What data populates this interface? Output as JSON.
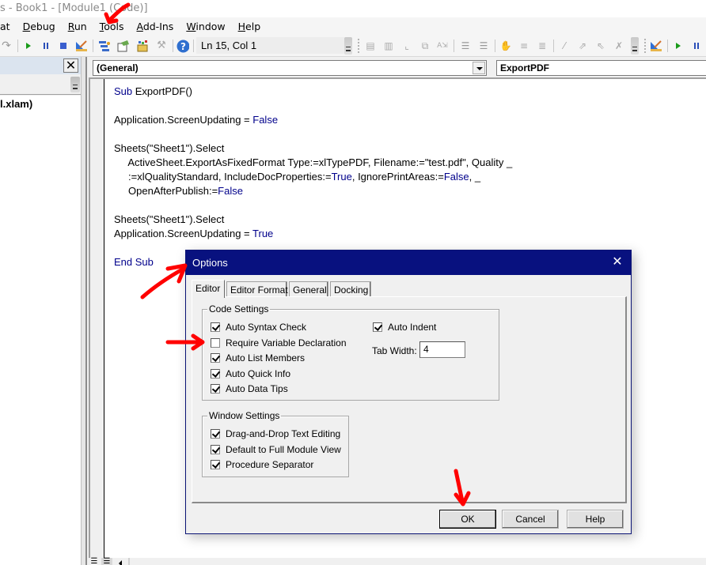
{
  "window": {
    "title": "s - Book1 - [Module1 (Code)]"
  },
  "menu": {
    "items": [
      {
        "label": "at",
        "accel": ""
      },
      {
        "label": "Debug",
        "accel": "D"
      },
      {
        "label": "Run",
        "accel": "R"
      },
      {
        "label": "Tools",
        "accel": "T"
      },
      {
        "label": "Add-Ins",
        "accel": "A"
      },
      {
        "label": "Window",
        "accel": "W"
      },
      {
        "label": "Help",
        "accel": "H"
      }
    ]
  },
  "toolbar": {
    "position_text": "Ln 15, Col 1",
    "icons": [
      "redo-icon",
      "run-icon",
      "break-icon",
      "reset-icon",
      "design-mode-icon",
      "project-explorer-icon",
      "properties-icon",
      "object-browser-icon",
      "toolbox-icon",
      "help-icon"
    ],
    "edit_icons": [
      "list-properties-icon",
      "list-constants-icon",
      "quick-info-icon",
      "parameter-info-icon",
      "complete-word-icon",
      "indent-icon",
      "outdent-icon",
      "toggle-breakpoint-icon",
      "comment-block-icon",
      "uncomment-block-icon",
      "toggle-bookmark-icon",
      "next-bookmark-icon",
      "previous-bookmark-icon",
      "clear-bookmarks-icon"
    ],
    "right_icons": [
      "design-mode-icon",
      "run-icon",
      "break-icon"
    ]
  },
  "project": {
    "close_label": "✕",
    "tree_item": "l.xlam)"
  },
  "editor": {
    "object_combo": "(General)",
    "procedure_combo": "ExportPDF",
    "code_lines": [
      [
        {
          "t": "Sub",
          "k": true
        },
        {
          "t": " ExportPDF()",
          "k": false
        }
      ],
      [],
      [
        {
          "t": "Application.ScreenUpdating = ",
          "k": false
        },
        {
          "t": "False",
          "k": true
        }
      ],
      [],
      [
        {
          "t": "Sheets(\"Sheet1\").Select",
          "k": false
        }
      ],
      [
        {
          "t": "     ActiveSheet.ExportAsFixedFormat Type:=xlTypePDF, Filename:=\"test.pdf\", Quality _",
          "k": false
        }
      ],
      [
        {
          "t": "     :=xlQualityStandard, IncludeDocProperties:=",
          "k": false
        },
        {
          "t": "True",
          "k": true
        },
        {
          "t": ", IgnorePrintAreas:=",
          "k": false
        },
        {
          "t": "False",
          "k": true
        },
        {
          "t": ", _",
          "k": false
        }
      ],
      [
        {
          "t": "     OpenAfterPublish:=",
          "k": false
        },
        {
          "t": "False",
          "k": true
        }
      ],
      [],
      [
        {
          "t": "Sheets(\"Sheet1\").Select",
          "k": false
        }
      ],
      [
        {
          "t": "Application.ScreenUpdating = ",
          "k": false
        },
        {
          "t": "True",
          "k": true
        }
      ],
      [],
      [
        {
          "t": "End Sub",
          "k": true
        }
      ]
    ]
  },
  "dialog": {
    "title": "Options",
    "close_label": "✕",
    "tabs": [
      {
        "label": "Editor",
        "active": true
      },
      {
        "label": "Editor Format",
        "active": false
      },
      {
        "label": "General",
        "active": false
      },
      {
        "label": "Docking",
        "active": false
      }
    ],
    "code_settings": {
      "label": "Code Settings",
      "options": [
        {
          "label": "Auto Syntax Check",
          "checked": true
        },
        {
          "label": "Require Variable Declaration",
          "checked": false
        },
        {
          "label": "Auto List Members",
          "checked": true
        },
        {
          "label": "Auto Quick Info",
          "checked": true
        },
        {
          "label": "Auto Data Tips",
          "checked": true
        }
      ],
      "auto_indent": {
        "label": "Auto Indent",
        "checked": true
      },
      "tab_width_label": "Tab Width:",
      "tab_width_value": "4"
    },
    "window_settings": {
      "label": "Window Settings",
      "options": [
        {
          "label": "Drag-and-Drop Text Editing",
          "checked": true
        },
        {
          "label": "Default to Full Module View",
          "checked": true
        },
        {
          "label": "Procedure Separator",
          "checked": true
        }
      ]
    },
    "buttons": {
      "ok": "OK",
      "cancel": "Cancel",
      "help": "Help"
    }
  },
  "colors": {
    "dialog_title_bg": "#08117f",
    "keyword": "#00008b",
    "annotation": "#ff0000"
  }
}
